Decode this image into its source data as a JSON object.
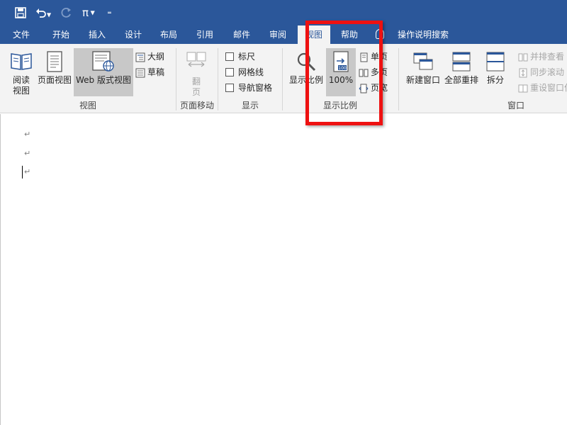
{
  "quick_access": {
    "save_icon": "save-icon",
    "undo_icon": "undo-icon",
    "redo_icon": "redo-icon",
    "equation_label": "π",
    "customize_icon": "customize-quick-access-icon"
  },
  "tabs": [
    {
      "label": "文件"
    },
    {
      "label": "开始"
    },
    {
      "label": "插入"
    },
    {
      "label": "设计"
    },
    {
      "label": "布局"
    },
    {
      "label": "引用"
    },
    {
      "label": "邮件"
    },
    {
      "label": "审阅"
    },
    {
      "label": "视图",
      "active": true
    },
    {
      "label": "帮助"
    }
  ],
  "tell_me": {
    "label": "操作说明搜索",
    "icon": "lightbulb-icon"
  },
  "ribbon": {
    "views": {
      "group_label": "视图",
      "read_mode": "阅读\n视图",
      "read_mode_line1": "阅读",
      "read_mode_line2": "视图",
      "print_layout": "页面视图",
      "web_layout": "Web 版式视图",
      "outline": "大纲",
      "draft": "草稿"
    },
    "page_movement": {
      "group_label": "页面移动",
      "flip_line1": "翻",
      "flip_line2": "页"
    },
    "show": {
      "group_label": "显示",
      "ruler": "标尺",
      "gridlines": "网格线",
      "nav_pane": "导航窗格"
    },
    "zoom": {
      "group_label": "显示比例",
      "zoom": "显示比例",
      "hundred": "100%",
      "one_page": "单页",
      "multiple_pages": "多页",
      "page_width": "页宽"
    },
    "window": {
      "group_label": "窗口",
      "new_window": "新建窗口",
      "arrange_all": "全部重排",
      "split": "拆分",
      "side_by_side": "并排查看",
      "sync_scroll": "同步滚动",
      "reset_position": "重设窗口位"
    }
  },
  "document": {
    "paragraph_mark": "↵"
  },
  "colors": {
    "titlebar": "#2b579a",
    "ribbon": "#f3f3f3",
    "highlight": "#ee1111"
  }
}
